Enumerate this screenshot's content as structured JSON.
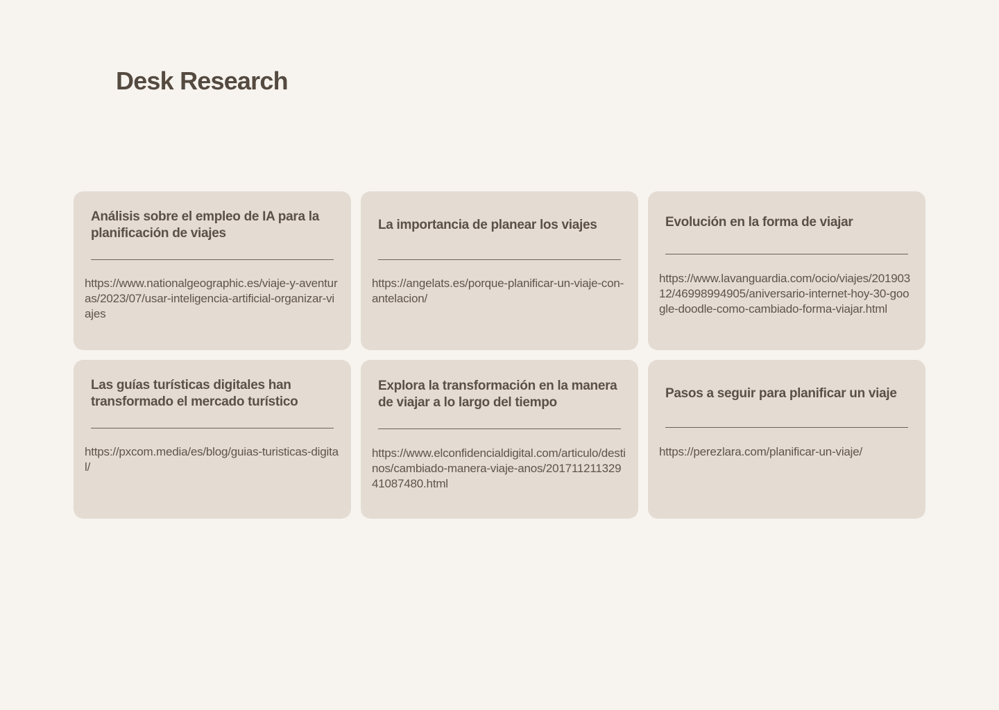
{
  "page": {
    "title": "Desk Research"
  },
  "cards": [
    {
      "title": "Análisis sobre el empleo de IA para la planificación de viajes",
      "url": "https://www.nationalgeographic.es/viaje-y-aventuras/2023/07/usar-inteligencia-artificial-organizar-viajes"
    },
    {
      "title": "La importancia de planear los viajes",
      "url": "https://angelats.es/porque-planificar-un-viaje-con-antelacion/"
    },
    {
      "title": "Evolución en la forma de viajar",
      "url": "https://www.lavanguardia.com/ocio/viajes/20190312/46998994905/aniversario-internet-hoy-30-google-doodle-como-cambiado-forma-viajar.html"
    },
    {
      "title": "Las guías turísticas digitales han transformado el mercado turístico",
      "url": "https://pxcom.media/es/blog/guias-turisticas-digital/"
    },
    {
      "title": "Explora la transformación en la manera de viajar a lo largo del tiempo",
      "url": "https://www.elconfidencialdigital.com/articulo/destinos/cambiado-manera-viaje-anos/20171121132941087480.html"
    },
    {
      "title": "Pasos a seguir para planificar un viaje",
      "url": "https://perezlara.com/planificar-un-viaje/"
    }
  ]
}
